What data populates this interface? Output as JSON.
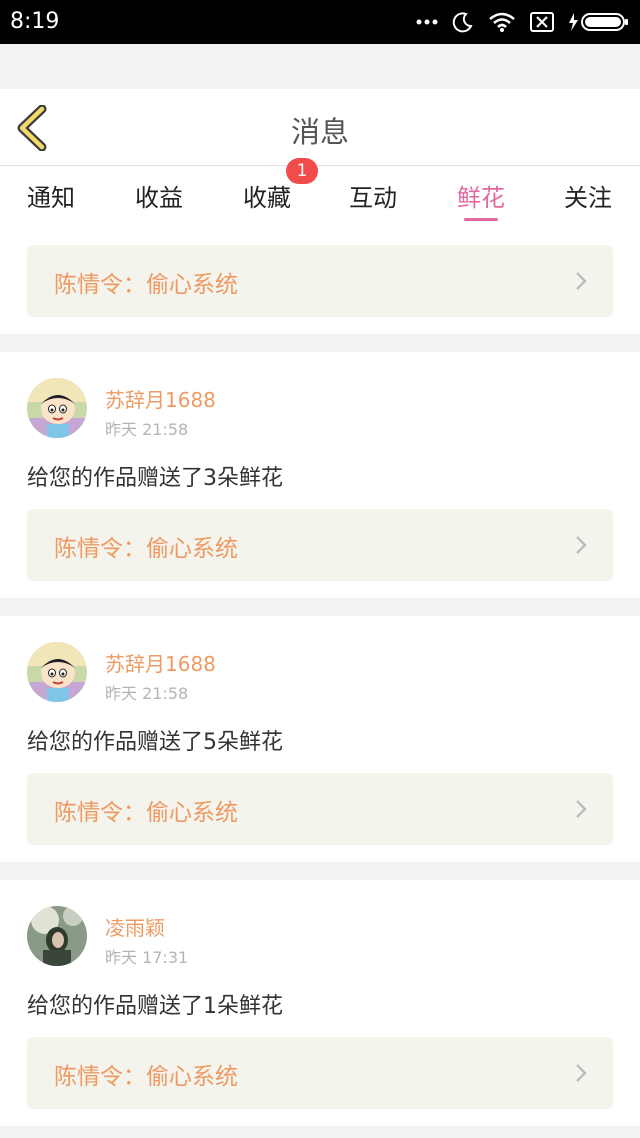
{
  "status": {
    "time": "8:19"
  },
  "header": {
    "title": "消息"
  },
  "tabs": [
    {
      "label": "通知"
    },
    {
      "label": "收益"
    },
    {
      "label": "收藏"
    },
    {
      "label": "互动"
    },
    {
      "label": "鲜花"
    },
    {
      "label": "关注"
    }
  ],
  "active_tab": "鲜花",
  "badge": {
    "count": "1"
  },
  "top_book": {
    "title": "陈情令：偷心系统"
  },
  "items": [
    {
      "username": "苏辞月1688",
      "time": "昨天 21:58",
      "message": "给您的作品赠送了3朵鲜花",
      "book": "陈情令：偷心系统"
    },
    {
      "username": "苏辞月1688",
      "time": "昨天 21:58",
      "message": "给您的作品赠送了5朵鲜花",
      "book": "陈情令：偷心系统"
    },
    {
      "username": "凌雨颖",
      "time": "昨天 17:31",
      "message": "给您的作品赠送了1朵鲜花",
      "book": "陈情令：偷心系统"
    }
  ],
  "colors": {
    "accent": "#e36aa0",
    "name": "#ee9a63",
    "badge": "#f24b4b"
  }
}
